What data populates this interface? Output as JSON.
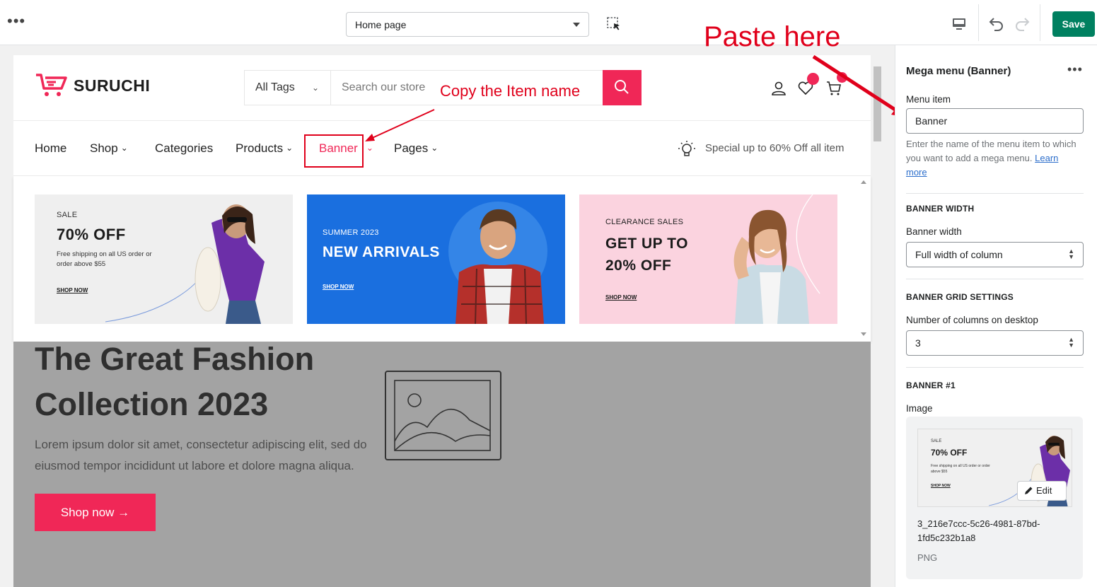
{
  "topbar": {
    "more_label": "•••",
    "page_select": "Home page",
    "save_label": "Save"
  },
  "site": {
    "logo": "SURUCHI",
    "tags_select": "All Tags",
    "search_placeholder": "Search our store",
    "nav": [
      {
        "label": "Home",
        "dropdown": false
      },
      {
        "label": "Shop",
        "dropdown": true
      },
      {
        "label": "Categories",
        "dropdown": false
      },
      {
        "label": "Products",
        "dropdown": true
      },
      {
        "label": "Banner",
        "dropdown": true
      },
      {
        "label": "Pages",
        "dropdown": true
      }
    ],
    "promo": "Special up to 60% Off all item",
    "accent_color": "#f02757"
  },
  "mega_menu": {
    "banners": [
      {
        "eyebrow": "SALE",
        "headline": "70% OFF",
        "desc": "Free shipping on all US order or order above $55",
        "cta": "SHOP NOW",
        "bg": "#efefef"
      },
      {
        "eyebrow": "SUMMER 2023",
        "headline": "NEW ARRIVALS",
        "desc": "",
        "cta": "SHOP NOW",
        "bg": "#1a6fdf"
      },
      {
        "eyebrow": "CLEARANCE SALES",
        "headline": "GET UP TO 20% OFF",
        "desc": "",
        "cta": "SHOP NOW",
        "bg": "#fbd3df"
      }
    ]
  },
  "hero": {
    "title": "The Great Fashion Collection 2023",
    "text": "Lorem ipsum dolor sit amet, consectetur adipiscing elit, sed do eiusmod tempor incididunt ut labore et dolore magna aliqua.",
    "cta": "Shop now →"
  },
  "annotations": {
    "copy": "Copy the Item name",
    "paste": "Paste here"
  },
  "sidebar": {
    "title": "Mega menu (Banner)",
    "menu_item_label": "Menu item",
    "menu_item_value": "Banner",
    "menu_item_help": "Enter the name of the menu item to which you want to add a mega menu.",
    "learn_more": "Learn more",
    "banner_width_heading": "BANNER WIDTH",
    "banner_width_label": "Banner width",
    "banner_width_value": "Full width of column",
    "grid_heading": "BANNER GRID SETTINGS",
    "columns_label": "Number of columns on desktop",
    "columns_value": "3",
    "banner1_heading": "BANNER #1",
    "image_label": "Image",
    "thumb_eyebrow": "SALE",
    "thumb_headline": "70% OFF",
    "thumb_desc": "Free shipping on all US order or order above $55",
    "thumb_cta": "SHOP NOW",
    "edit_label": "Edit",
    "file_name": "3_216e7ccc-5c26-4981-87bd-1fd5c232b1a8",
    "file_type": "PNG"
  }
}
